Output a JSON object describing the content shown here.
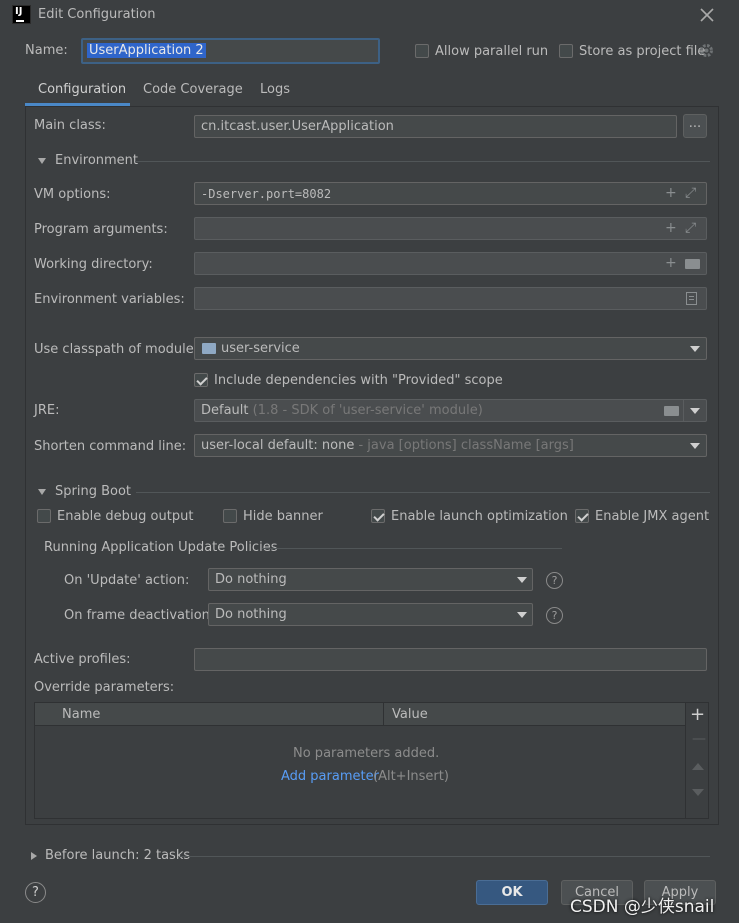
{
  "window": {
    "title": "Edit Configuration",
    "app_icon": "IJ"
  },
  "name": {
    "label": "Name:",
    "value": "UserApplication 2"
  },
  "allow_parallel": {
    "label": "Allow parallel run",
    "checked": false
  },
  "store_project": {
    "label": "Store as project file",
    "checked": false
  },
  "tabs": [
    {
      "label": "Configuration",
      "active": true
    },
    {
      "label": "Code Coverage",
      "active": false
    },
    {
      "label": "Logs",
      "active": false
    }
  ],
  "main_class": {
    "label": "Main class:",
    "value": "cn.itcast.user.UserApplication",
    "browse": "..."
  },
  "environment": {
    "section": "Environment",
    "vm_label": "VM options:",
    "vm_value": "-Dserver.port=8082",
    "prog_label": "Program arguments:",
    "prog_value": "",
    "workdir_label": "Working directory:",
    "workdir_value": "",
    "envvars_label": "Environment variables:",
    "envvars_value": ""
  },
  "classpath": {
    "label": "Use classpath of module:",
    "value": "user-service"
  },
  "include_deps": {
    "label": "Include dependencies with \"Provided\" scope",
    "checked": true
  },
  "jre": {
    "label": "JRE:",
    "value": "Default",
    "hint": "(1.8 - SDK of 'user-service' module)"
  },
  "shorten": {
    "label": "Shorten command line:",
    "value": "user-local default: none",
    "hint": "- java [options] className [args]"
  },
  "spring_boot": {
    "section": "Spring Boot",
    "debug": {
      "label": "Enable debug output",
      "checked": false
    },
    "hide_banner": {
      "label": "Hide banner",
      "checked": false
    },
    "launch_opt": {
      "label": "Enable launch optimization",
      "checked": true
    },
    "jmx": {
      "label": "Enable JMX agent",
      "checked": true
    },
    "policies_title": "Running Application Update Policies",
    "on_update_label": "On 'Update' action:",
    "on_update_value": "Do nothing",
    "on_frame_label": "On frame deactivation:",
    "on_frame_value": "Do nothing"
  },
  "active_profiles": {
    "label": "Active profiles:",
    "value": ""
  },
  "override": {
    "label": "Override parameters:",
    "columns": [
      "Name",
      "Value"
    ],
    "empty_text": "No parameters added.",
    "add_link": "Add parameter",
    "add_shortcut": "(Alt+Insert)"
  },
  "before_launch": {
    "label": "Before launch: 2 tasks"
  },
  "buttons": {
    "ok": "OK",
    "cancel": "Cancel",
    "apply": "Apply",
    "help": "?"
  },
  "watermark": "CSDN @少侠snail",
  "colors": {
    "accent": "#4a88c7",
    "ok_button": "#365880",
    "link": "#589df6",
    "background": "#3c3f41"
  }
}
